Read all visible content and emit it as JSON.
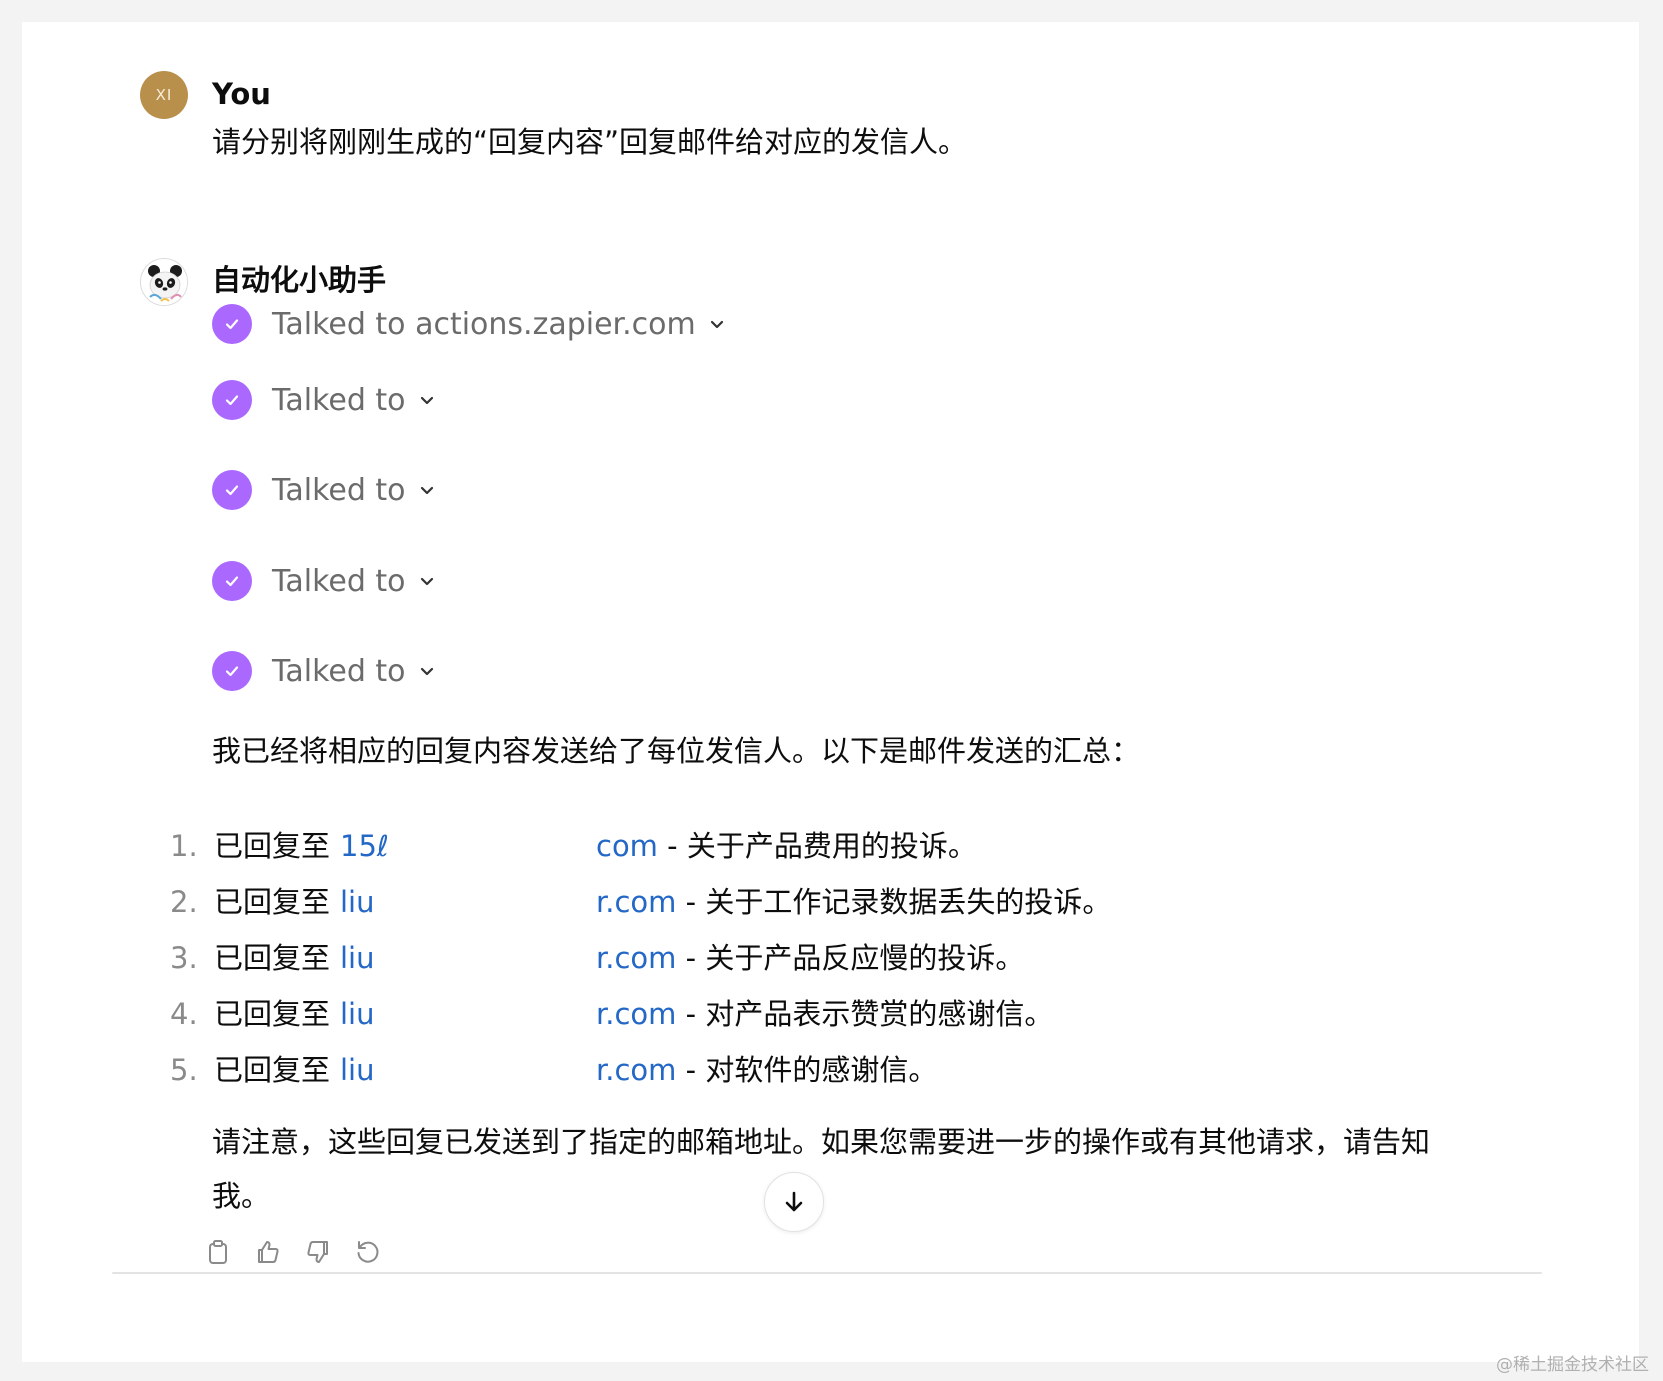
{
  "user": {
    "initials": "XI",
    "name": "You",
    "message": "请分别将刚刚生成的“回复内容”回复邮件给对应的发信人。"
  },
  "assistant": {
    "name": "自动化小助手",
    "actions": [
      {
        "label": "Talked to actions.zapier.com"
      },
      {
        "label": "Talked to"
      },
      {
        "label": "Talked to"
      },
      {
        "label": "Talked to"
      },
      {
        "label": "Talked to"
      }
    ],
    "intro": "我已经将相应的回复内容发送给了每位发信人。以下是邮件发送的汇总：",
    "list": [
      {
        "num": "1.",
        "prefix": "已回复至",
        "addr_start": "15ℓ",
        "addr_end": "com",
        "desc": " - 关于产品费用的投诉。"
      },
      {
        "num": "2.",
        "prefix": "已回复至",
        "addr_start": "liu",
        "addr_end": "r.com",
        "desc": " - 关于工作记录数据丢失的投诉。"
      },
      {
        "num": "3.",
        "prefix": "已回复至",
        "addr_start": "liu",
        "addr_end": "r.com",
        "desc": " - 关于产品反应慢的投诉。"
      },
      {
        "num": "4.",
        "prefix": "已回复至",
        "addr_start": "liu",
        "addr_end": "r.com",
        "desc": " - 对产品表示赞赏的感谢信。"
      },
      {
        "num": "5.",
        "prefix": "已回复至",
        "addr_start": "liu",
        "addr_end": "r.com",
        "desc": " - 对软件的感谢信。"
      }
    ],
    "closing_line1": "请注意，这些回复已发送到了指定的邮箱地址。如果您需要进一步的操作或有其他请求，请告知",
    "closing_line2": "我。"
  },
  "toolbar": {
    "icons": [
      "clipboard-icon",
      "thumbs-up-icon",
      "thumbs-down-icon",
      "regenerate-icon"
    ]
  },
  "colors": {
    "accent_check": "#ab68ff",
    "link": "#2468c7",
    "user_avatar": "#b8904b"
  },
  "watermark": "@稀土掘金技术社区"
}
